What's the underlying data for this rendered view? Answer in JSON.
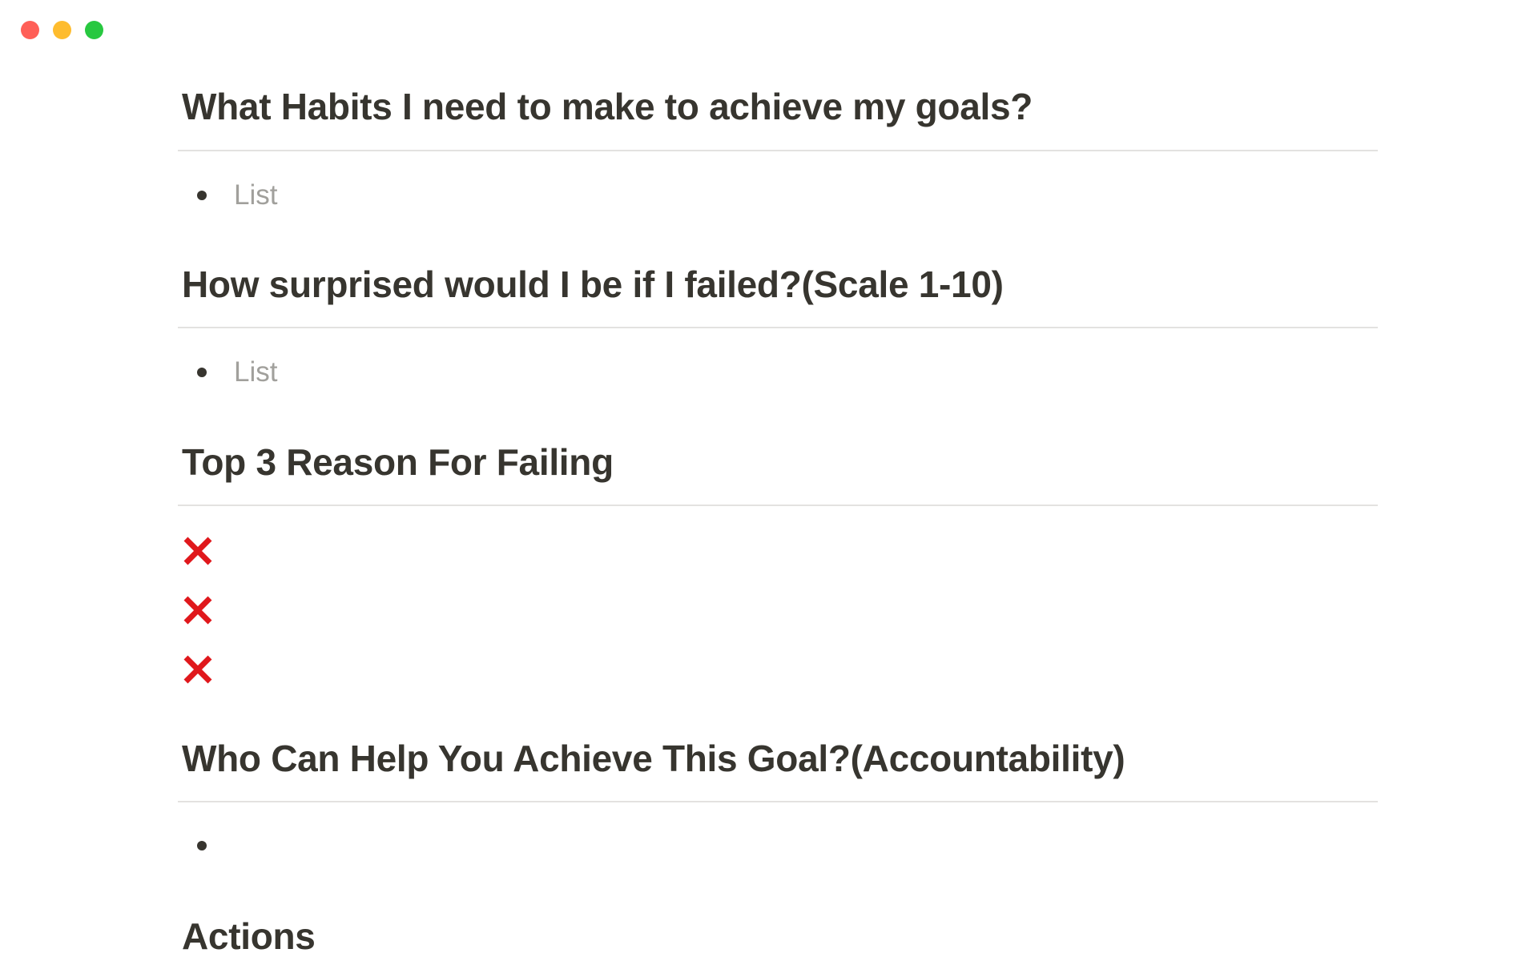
{
  "window": {
    "controls": [
      {
        "name": "close",
        "color": "#ff5f57"
      },
      {
        "name": "minimize",
        "color": "#febc2e"
      },
      {
        "name": "zoom",
        "color": "#28c840"
      }
    ]
  },
  "sections": {
    "habits": {
      "heading": "What Habits I need to make to achieve my goals?",
      "item_placeholder": "List"
    },
    "surprise": {
      "heading": "How surprised would I be if I failed?(Scale 1-10)",
      "item_placeholder": "List"
    },
    "reasons": {
      "heading": "Top 3 Reason For Failing",
      "items": [
        {
          "icon": "cross-mark-icon",
          "color": "#e0181c"
        },
        {
          "icon": "cross-mark-icon",
          "color": "#e0181c"
        },
        {
          "icon": "cross-mark-icon",
          "color": "#e0181c"
        }
      ]
    },
    "accountability": {
      "heading": "Who Can Help You Achieve This Goal?(Accountability)",
      "item_text": ""
    },
    "actions": {
      "heading": "Actions"
    }
  }
}
